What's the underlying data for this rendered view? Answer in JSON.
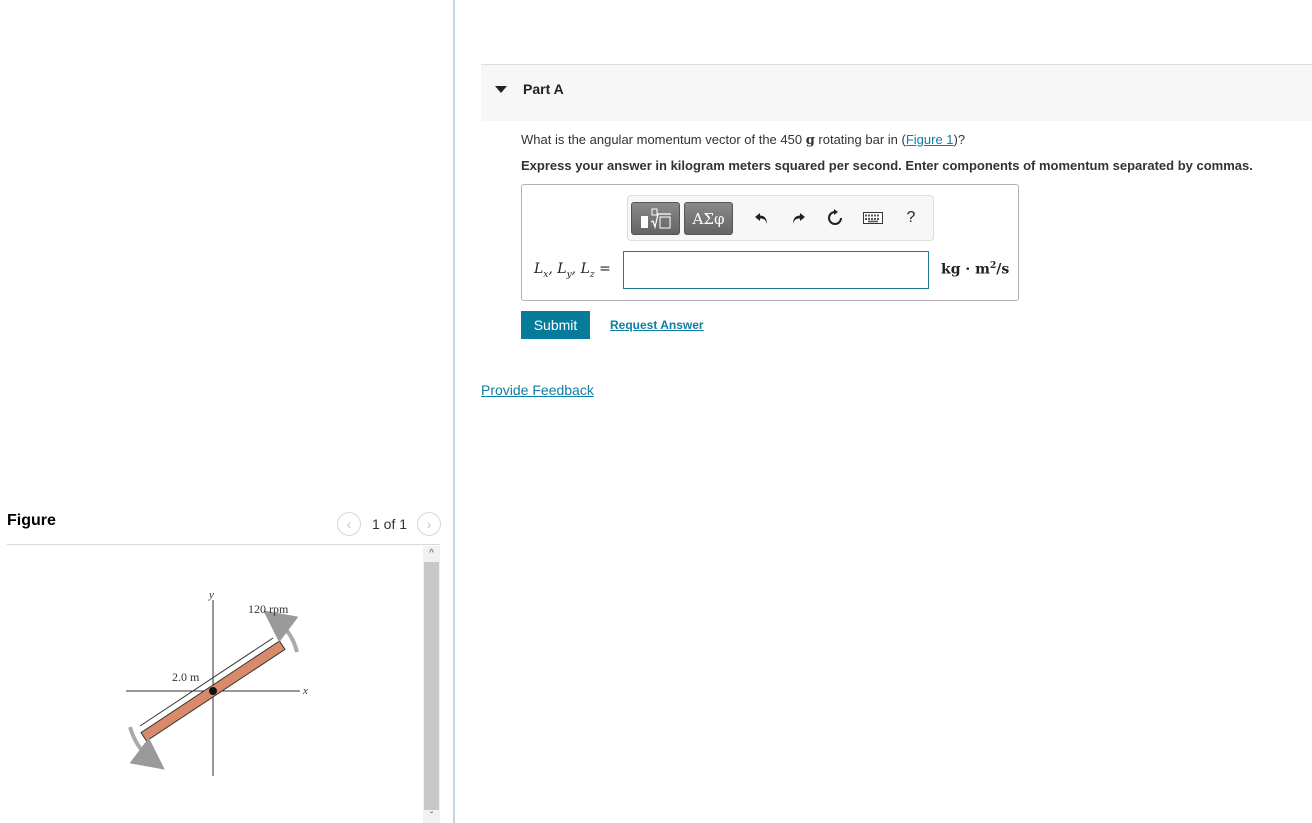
{
  "figure_panel": {
    "title": "Figure",
    "pager": {
      "prev_icon": "chevron-left-icon",
      "label": "1 of 1",
      "next_icon": "chevron-right-icon"
    },
    "scroll_up": "^",
    "scroll_down": "v",
    "diagram": {
      "y_axis_label": "y",
      "x_axis_label": "x",
      "length_label": "2.0 m",
      "speed_label": "120 rpm",
      "bar_color": "#d98a6a"
    }
  },
  "part": {
    "caret_icon": "caret-down-icon",
    "title": "Part A",
    "question_before": "What is the angular momentum vector of the 450 ",
    "question_unit": "g",
    "question_mid": " rotating bar in (",
    "figure_link": "Figure 1",
    "question_after": ")?",
    "instruction": "Express your answer in kilogram meters squared per second. Enter components of momentum separated by commas.",
    "toolbar": {
      "templates_icon": "templates-sqrt-icon",
      "greek_label": "ΑΣφ",
      "undo_icon": "undo-icon",
      "redo_icon": "redo-icon",
      "reset_icon": "reset-icon",
      "keyboard_icon": "keyboard-icon",
      "help_label": "?"
    },
    "answer": {
      "label_L": "L",
      "sub_x": "x",
      "sub_y": "y",
      "sub_z": "z",
      "sep": ", ",
      "equals": " =",
      "value": "",
      "units_base": "kg · m",
      "units_exp": "2",
      "units_tail": "/s"
    },
    "submit_label": "Submit",
    "request_answer_label": "Request Answer"
  },
  "feedback_label": "Provide Feedback",
  "colors": {
    "accent": "#077b9a",
    "link": "#0d7ea5"
  }
}
